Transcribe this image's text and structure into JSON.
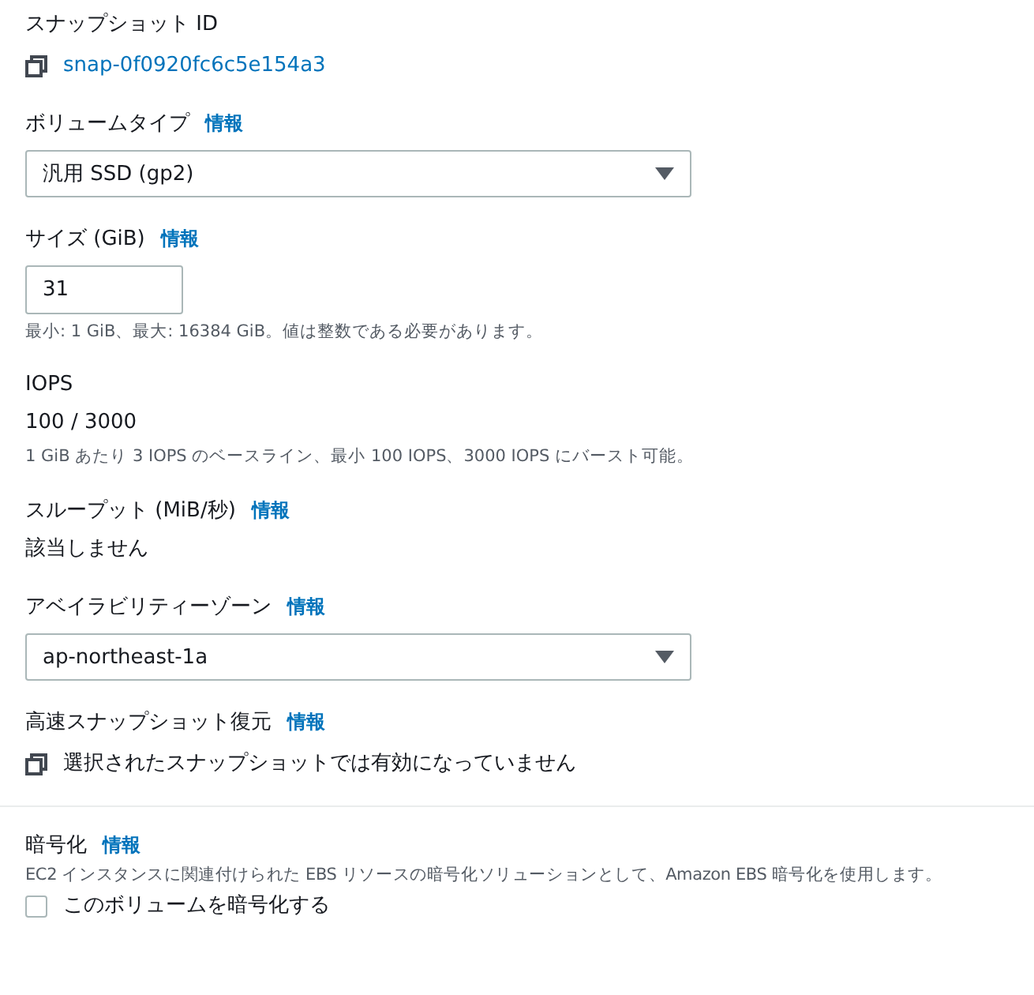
{
  "fields": [
    {
      "kind": "copy_link",
      "label": "スナップショット ID",
      "value": "snap-0f0920fc6c5e154a3"
    },
    {
      "kind": "select",
      "label": "ボリュームタイプ",
      "info": "情報",
      "value": "汎用 SSD (gp2)"
    },
    {
      "kind": "input",
      "label": "サイズ (GiB)",
      "info": "情報",
      "value": "31",
      "hint": "最小: 1 GiB、最大: 16384 GiB。値は整数である必要があります。"
    },
    {
      "kind": "text",
      "label": "IOPS",
      "value": "100 / 3000",
      "hint": "1 GiB あたり 3 IOPS のベースライン、最小 100 IOPS、3000 IOPS にバースト可能。"
    },
    {
      "kind": "text",
      "label": "スループット (MiB/秒)",
      "info": "情報",
      "value": "該当しません"
    },
    {
      "kind": "select",
      "label": "アベイラビリティーゾーン",
      "info": "情報",
      "value": "ap-northeast-1a"
    },
    {
      "kind": "copy_text",
      "label": "高速スナップショット復元",
      "info": "情報",
      "value": "選択されたスナップショットでは有効になっていません"
    },
    {
      "kind": "divider"
    },
    {
      "kind": "checkbox",
      "label": "暗号化",
      "info": "情報",
      "description": "EC2 インスタンスに関連付けられた EBS リソースの暗号化ソリューションとして、Amazon EBS 暗号化を使用します。",
      "option": "このボリュームを暗号化する",
      "checked": false
    }
  ]
}
